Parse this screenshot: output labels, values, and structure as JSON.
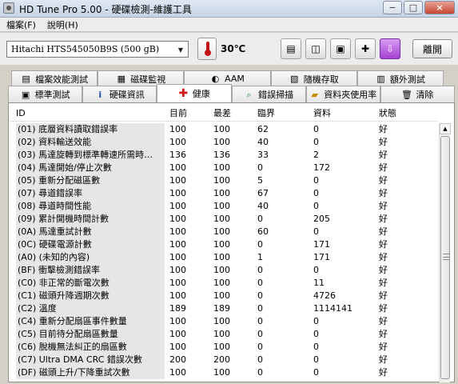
{
  "window": {
    "title": "HD Tune Pro  5.00 - 硬碟檢測-維護工具",
    "controls": [
      "minimize-icon",
      "maximize-icon",
      "close-icon"
    ]
  },
  "menubar": {
    "items": [
      "檔案(F)",
      "說明(H)"
    ]
  },
  "toolbar": {
    "drive": "Hitachi HTS545050B9S    (500 gB)",
    "temperature": "30℃",
    "exit_label": "離開",
    "buttons": [
      "copy-text-icon",
      "copy-screenshot-icon",
      "save-icon",
      "options-icon",
      "download-icon"
    ]
  },
  "tabs": {
    "row1": [
      {
        "label": "檔案效能測試",
        "icon": "file-benchmark-icon"
      },
      {
        "label": "磁碟監視",
        "icon": "disk-monitor-icon"
      },
      {
        "label": "AAM",
        "icon": "speaker-icon"
      },
      {
        "label": "隨機存取",
        "icon": "random-access-icon"
      },
      {
        "label": "額外測試",
        "icon": "extra-tests-icon"
      }
    ],
    "row2": [
      {
        "label": "標準測試",
        "icon": "benchmark-icon"
      },
      {
        "label": "硬碟資訊",
        "icon": "info-icon"
      },
      {
        "label": "健康",
        "icon": "health-cross-icon",
        "active": true
      },
      {
        "label": "錯誤掃描",
        "icon": "error-scan-icon"
      },
      {
        "label": "資料夾使用率",
        "icon": "folder-usage-icon"
      },
      {
        "label": "清除",
        "icon": "erase-trash-icon"
      }
    ]
  },
  "health_table": {
    "headers": [
      "ID",
      "目前",
      "最差",
      "臨界",
      "資料",
      "狀態"
    ],
    "rows": [
      {
        "id": "(01) 底層資料讀取錯誤率",
        "current": "100",
        "worst": "100",
        "threshold": "62",
        "data": "0",
        "status": "好"
      },
      {
        "id": "(02) 資料輸送效能",
        "current": "100",
        "worst": "100",
        "threshold": "40",
        "data": "0",
        "status": "好"
      },
      {
        "id": "(03) 馬達旋轉到標準轉速所需時…",
        "current": "136",
        "worst": "136",
        "threshold": "33",
        "data": "2",
        "status": "好"
      },
      {
        "id": "(04) 馬達開始/停止次數",
        "current": "100",
        "worst": "100",
        "threshold": "0",
        "data": "172",
        "status": "好"
      },
      {
        "id": "(05) 重新分配磁區數",
        "current": "100",
        "worst": "100",
        "threshold": "5",
        "data": "0",
        "status": "好"
      },
      {
        "id": "(07) 尋道錯誤率",
        "current": "100",
        "worst": "100",
        "threshold": "67",
        "data": "0",
        "status": "好"
      },
      {
        "id": "(08) 尋道時間性能",
        "current": "100",
        "worst": "100",
        "threshold": "40",
        "data": "0",
        "status": "好"
      },
      {
        "id": "(09) 累計開機時間計數",
        "current": "100",
        "worst": "100",
        "threshold": "0",
        "data": "205",
        "status": "好"
      },
      {
        "id": "(0A) 馬達重試計數",
        "current": "100",
        "worst": "100",
        "threshold": "60",
        "data": "0",
        "status": "好"
      },
      {
        "id": "(0C) 硬碟電源計數",
        "current": "100",
        "worst": "100",
        "threshold": "0",
        "data": "171",
        "status": "好"
      },
      {
        "id": "(A0) (未知的內容)",
        "current": "100",
        "worst": "100",
        "threshold": "1",
        "data": "171",
        "status": "好"
      },
      {
        "id": "(BF) 衝擊檢測錯誤率",
        "current": "100",
        "worst": "100",
        "threshold": "0",
        "data": "0",
        "status": "好"
      },
      {
        "id": "(C0) 非正常的斷電次數",
        "current": "100",
        "worst": "100",
        "threshold": "0",
        "data": "11",
        "status": "好"
      },
      {
        "id": "(C1) 磁頭升降週期次數",
        "current": "100",
        "worst": "100",
        "threshold": "0",
        "data": "4726",
        "status": "好"
      },
      {
        "id": "(C2) 溫度",
        "current": "189",
        "worst": "189",
        "threshold": "0",
        "data": "1114141",
        "status": "好"
      },
      {
        "id": "(C4) 重新分配扇區事件數量",
        "current": "100",
        "worst": "100",
        "threshold": "0",
        "data": "0",
        "status": "好"
      },
      {
        "id": "(C5) 目前待分配扇區數量",
        "current": "100",
        "worst": "100",
        "threshold": "0",
        "data": "0",
        "status": "好"
      },
      {
        "id": "(C6) 脫機無法糾正的扇區數",
        "current": "100",
        "worst": "100",
        "threshold": "0",
        "data": "0",
        "status": "好"
      },
      {
        "id": "(C7) Ultra DMA CRC 錯誤次數",
        "current": "200",
        "worst": "200",
        "threshold": "0",
        "data": "0",
        "status": "好"
      },
      {
        "id": "(DF) 磁頭上升/下降重試次數",
        "current": "100",
        "worst": "100",
        "threshold": "0",
        "data": "0",
        "status": "好"
      }
    ]
  }
}
